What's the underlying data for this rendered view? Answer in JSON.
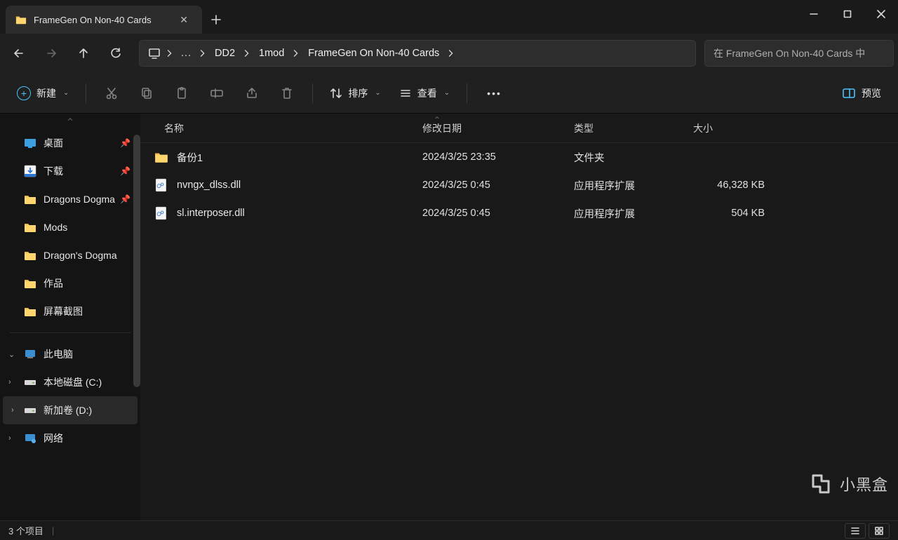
{
  "tab": {
    "title": "FrameGen On Non-40 Cards"
  },
  "breadcrumb": {
    "items": [
      "DD2",
      "1mod",
      "FrameGen On Non-40 Cards"
    ]
  },
  "search": {
    "placeholder": "在 FrameGen On Non-40 Cards 中"
  },
  "toolbar": {
    "new_label": "新建",
    "sort_label": "排序",
    "view_label": "查看",
    "preview_label": "预览"
  },
  "sidebar": {
    "quick": [
      {
        "label": "桌面",
        "icon": "desktop",
        "pinned": true
      },
      {
        "label": "下载",
        "icon": "download",
        "pinned": true
      },
      {
        "label": "Dragons Dogma",
        "icon": "folder",
        "pinned": true
      },
      {
        "label": "Mods",
        "icon": "folder",
        "pinned": false
      },
      {
        "label": "Dragon's Dogma",
        "icon": "folder",
        "pinned": false
      },
      {
        "label": "作品",
        "icon": "folder",
        "pinned": false
      },
      {
        "label": "屏幕截图",
        "icon": "folder",
        "pinned": false
      }
    ],
    "pc_label": "此电脑",
    "drives": [
      {
        "label": "本地磁盘 (C:)"
      },
      {
        "label": "新加卷 (D:)"
      }
    ],
    "network_label": "网络"
  },
  "columns": {
    "name": "名称",
    "date": "修改日期",
    "type": "类型",
    "size": "大小"
  },
  "files": [
    {
      "name": "备份1",
      "date": "2024/3/25 23:35",
      "type": "文件夹",
      "size": "",
      "icon": "folder"
    },
    {
      "name": "nvngx_dlss.dll",
      "date": "2024/3/25 0:45",
      "type": "应用程序扩展",
      "size": "46,328 KB",
      "icon": "dll"
    },
    {
      "name": "sl.interposer.dll",
      "date": "2024/3/25 0:45",
      "type": "应用程序扩展",
      "size": "504 KB",
      "icon": "dll"
    }
  ],
  "status": {
    "item_count": "3 个项目"
  },
  "watermark": "小黑盒"
}
